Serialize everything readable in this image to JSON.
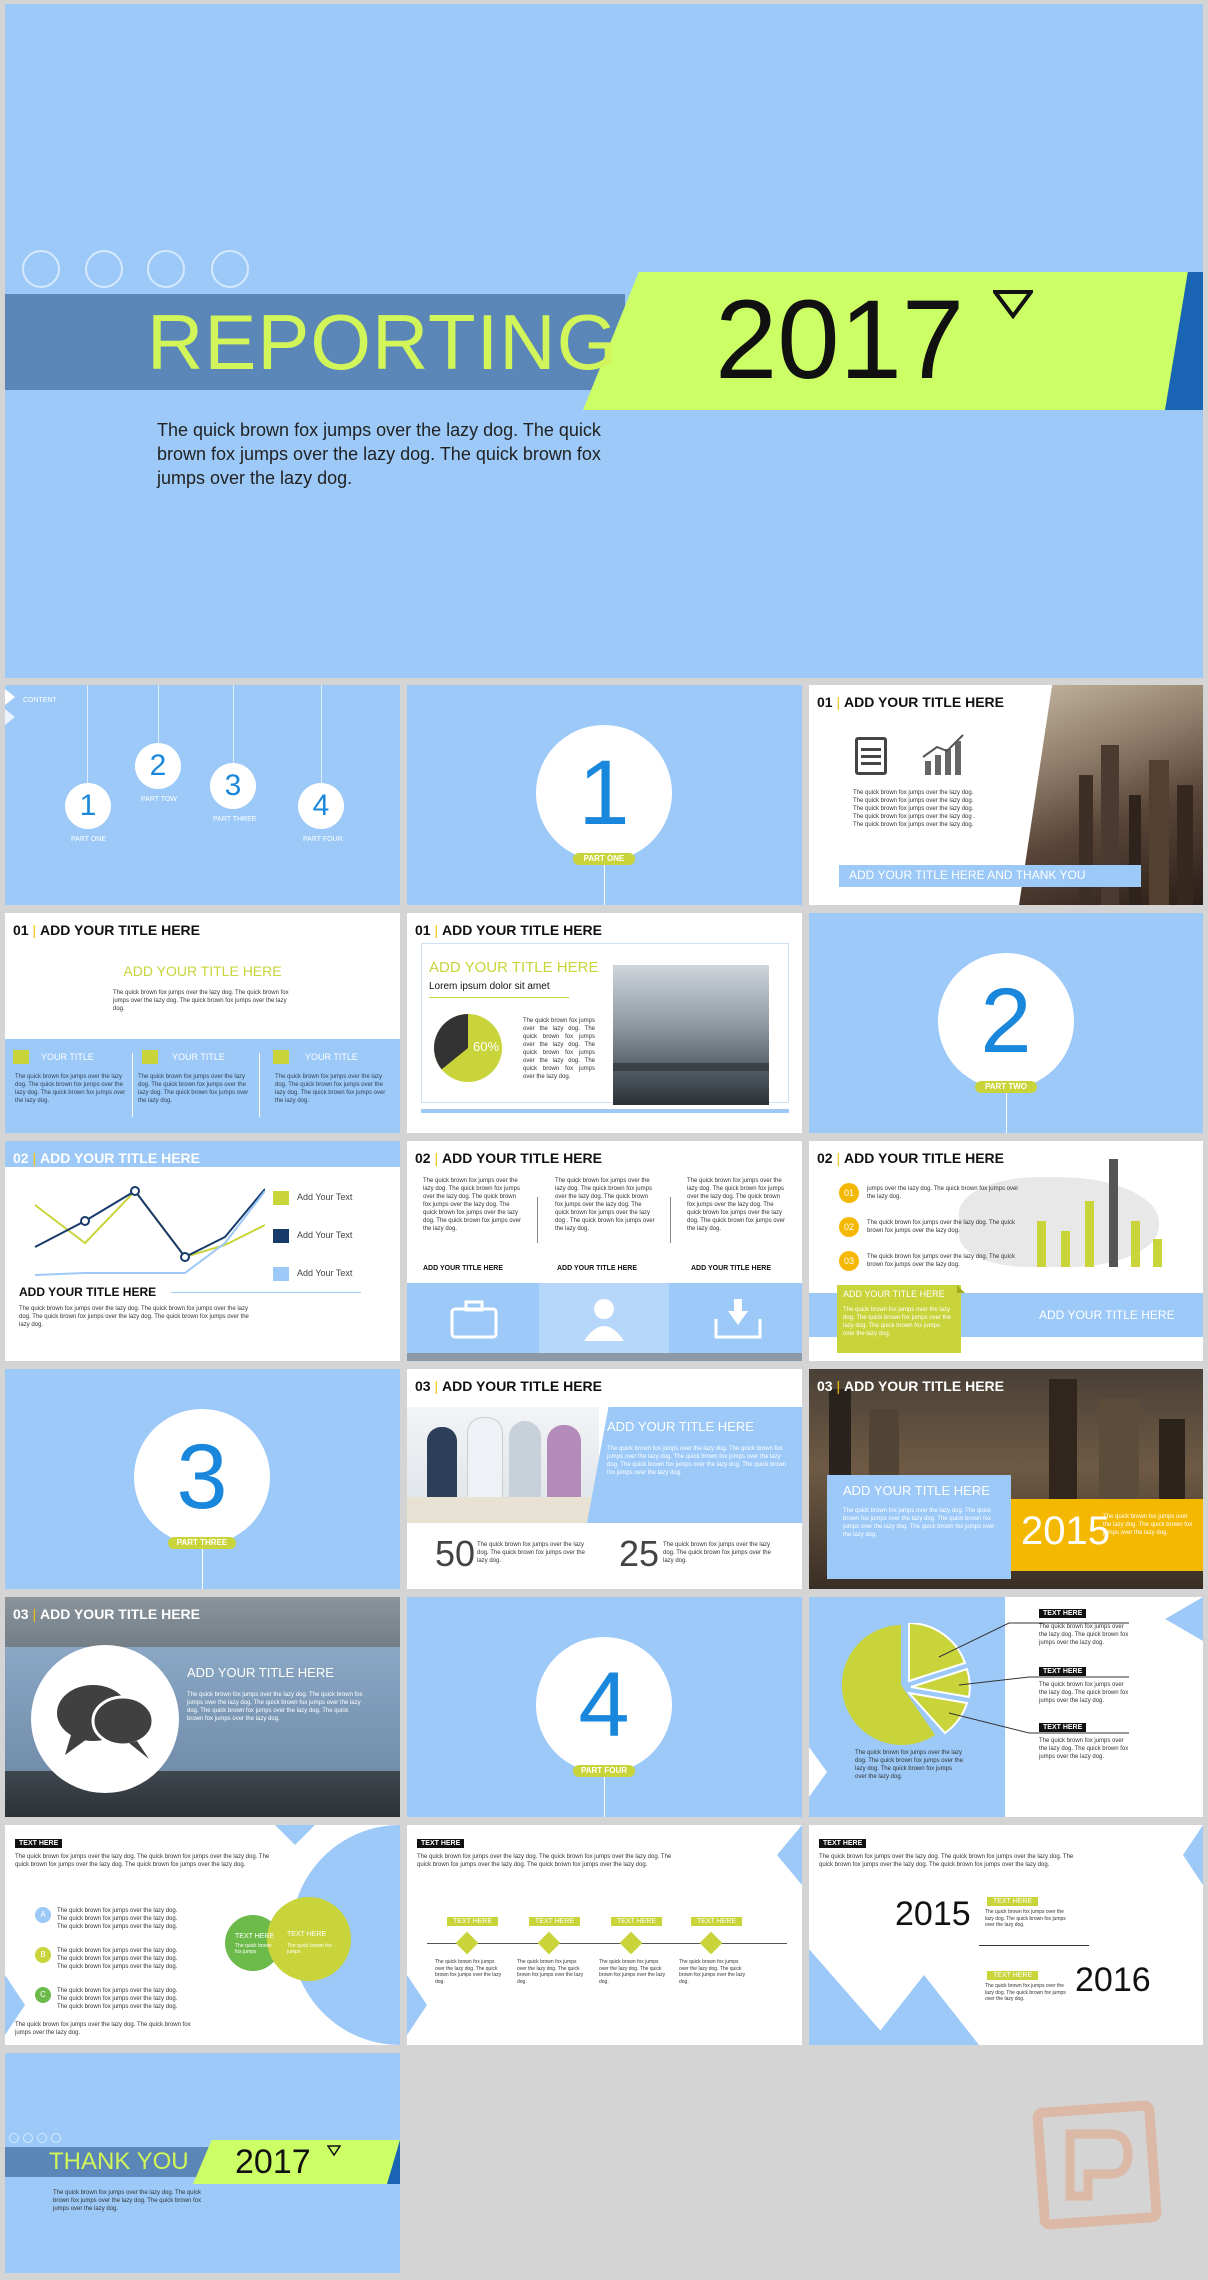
{
  "s1": {
    "title": "REPORTING",
    "year": "2017",
    "body": "The quick brown fox jumps over the lazy dog. The quick brown fox jumps over the lazy dog. The quick brown fox jumps over the lazy dog."
  },
  "s2": {
    "content": "CONTENT",
    "items": [
      {
        "n": "1",
        "label": "PART ONE"
      },
      {
        "n": "2",
        "label": "PART TOW"
      },
      {
        "n": "3",
        "label": "PART THREE"
      },
      {
        "n": "4",
        "label": "PART FOUR"
      }
    ]
  },
  "s3": {
    "n": "1",
    "label": "PART ONE"
  },
  "s4": {
    "num": "01",
    "title": "ADD YOUR TITLE HERE",
    "body": "The quick brown fox jumps over the lazy dog. The quick brown fox jumps over the lazy dog. The quick brown fox jumps over the lazy dog. The quick brown fox jumps over the lazy dog . The quick brown fox jumps over the lazy dog.",
    "banner": "ADD YOUR TITLE HERE AND THANK YOU"
  },
  "s5": {
    "num": "01",
    "title": "ADD YOUR TITLE HERE",
    "subtitle": "ADD YOUR TITLE HERE",
    "body": "The quick brown fox jumps over the lazy dog. The quick brown fox jumps over the lazy dog. The quick brown fox jumps over the lazy dog.",
    "cols": [
      {
        "label": "YOUR TITLE",
        "text": "The quick brown fox jumps over the lazy dog. The quick brown fox jumps over the lazy dog. The quick brown fox jumps over the lazy dog."
      },
      {
        "label": "YOUR TITLE",
        "text": "The quick brown fox jumps over the lazy dog. The quick brown fox jumps over the lazy dog. The quick brown fox jumps over the lazy dog."
      },
      {
        "label": "YOUR TITLE",
        "text": "The quick brown fox jumps over the lazy dog. The quick brown fox jumps over the lazy dog. The quick brown fox jumps over the lazy dog."
      }
    ]
  },
  "s6": {
    "num": "01",
    "title": "ADD YOUR TITLE HERE",
    "subtitle": "ADD YOUR TITLE HERE",
    "lorem": "Lorem ipsum dolor sit amet",
    "pct": "60%",
    "pct_value": 60,
    "body": "The quick brown fox jumps over the lazy dog. The quick brown fox jumps over the lazy dog. The quick brown fox jumps over the lazy dog. The quick brown fox jumps over the lazy dog."
  },
  "s7": {
    "n": "2",
    "label": "PART TWO"
  },
  "s8": {
    "num": "02",
    "title": "ADD YOUR TITLE HERE",
    "legend": [
      "Add Your Text",
      "Add Your Text",
      "Add Your Text"
    ],
    "subtitle": "ADD YOUR TITLE HERE",
    "body": "The quick brown fox jumps over the lazy dog. The quick brown fox jumps over the lazy dog. The quick brown fox jumps over the lazy dog. The quick brown fox jumps over the lazy dog."
  },
  "s9": {
    "num": "02",
    "title": "ADD YOUR TITLE HERE",
    "cols": [
      {
        "text": "The quick brown fox jumps over the lazy dog. The quick brown fox jumps over the lazy dog. The quick brown fox jumps over the lazy dog. The quick brown fox jumps over the lazy dog. The quick brown fox jumps over the lazy dog.",
        "label": "ADD YOUR TITLE HERE"
      },
      {
        "text": "The quick brown fox jumps over the lazy dog. The quick brown fox jumps over the lazy dog. The quick brown fox jumps over the lazy dog. The quick brown fox jumps over the lazy dog . The quick brown fox jumps over the lazy dog.",
        "label": "ADD YOUR TITLE HERE"
      },
      {
        "text": "The quick brown fox jumps over the lazy dog. The quick brown fox jumps over the lazy dog. The quick brown fox jumps over the lazy dog. The quick brown fox jumps over the lazy dog. The quick brown fox jumps over the lazy dog.",
        "label": "ADD YOUR TITLE HERE"
      }
    ]
  },
  "s10": {
    "num": "02",
    "title": "ADD YOUR TITLE HERE",
    "items": [
      {
        "n": "01",
        "text": "jumps over the lazy dog. The quick brown fox jumps over the lazy dog."
      },
      {
        "n": "02",
        "text": "The quick brown fox jumps over the lazy dog. The quick brown fox jumps over the lazy dog."
      },
      {
        "n": "03",
        "text": "The quick brown fox jumps over the lazy dog. The quick brown fox jumps over the lazy dog."
      }
    ],
    "box_title": "ADD YOUR TITLE HERE",
    "box_text": "The quick brown fox jumps over the lazy dog. The quick brown fox jumps over the lazy dog. The quick brown fox jumps over the lazy dog.",
    "right_title": "ADD YOUR TITLE HERE"
  },
  "s11": {
    "n": "3",
    "label": "PART THREE"
  },
  "s12": {
    "num": "03",
    "title": "ADD YOUR TITLE HERE",
    "subtitle": "ADD YOUR TITLE HERE",
    "body": "The quick brown fox jumps over the lazy dog. The quick brown fox jumps over the lazy dog. The quick brown fox jumps over the lazy dog. The quick brown fox jumps over the lazy dog. The quick brown fox jumps over the lazy dog.",
    "stats": [
      {
        "n": "50",
        "text": "The quick brown fox jumps over the lazy dog. The quick brown fox jumps over the lazy dog."
      },
      {
        "n": "25",
        "text": "The quick brown fox jumps over the lazy dog. The quick brown fox jumps over the lazy dog."
      }
    ]
  },
  "s13": {
    "num": "03",
    "title": "ADD YOUR TITLE HERE",
    "subtitle": "ADD YOUR TITLE HERE",
    "body": "The quick brown fox jumps over the lazy dog. The quick brown fox jumps over the lazy dog. The quick brown fox jumps over the lazy dog. The quick brown fox jumps over the lazy dog.",
    "year": "2015",
    "side": "The quick brown fox jumps over the lazy dog. The quick brown fox jumps over the lazy dog."
  },
  "s14": {
    "num": "03",
    "title": "ADD YOUR TITLE HERE",
    "subtitle": "ADD YOUR TITLE HERE",
    "body": "The quick brown fox jumps over the lazy dog. The quick brown fox jumps over the lazy dog. The quick brown fox jumps over the lazy dog. The quick brown fox jumps over the lazy dog. The quick brown fox jumps over the lazy dog."
  },
  "s15": {
    "n": "4",
    "label": "PART FOUR"
  },
  "s16": {
    "tags": [
      "TEXT HERE",
      "TEXT HERE",
      "TEXT HERE"
    ],
    "texts": [
      "The quick brown fox jumps over the lazy dog. The quick brown fox jumps over the lazy dog.",
      "The quick brown fox jumps over the lazy dog. The quick brown fox jumps over the lazy dog.",
      "The quick brown fox jumps over the lazy dog. The quick brown fox jumps over the lazy dog."
    ],
    "caption": "The quick brown fox jumps over the lazy dog. The quick brown fox jumps over the lazy dog. The quick brown fox jumps over the lazy dog."
  },
  "s17": {
    "tag": "TEXT HERE",
    "intro": "The quick brown fox jumps over the lazy dog. The quick brown fox jumps over the lazy dog. The quick brown fox jumps over the lazy dog. The quick brown fox jumps over the lazy dog.",
    "items": [
      {
        "l": "A",
        "t": "The quick brown fox jumps over the lazy dog. The quick brown fox jumps over the lazy dog. The quick brown fox jumps over the lazy dog."
      },
      {
        "l": "B",
        "t": "The quick brown fox jumps over the lazy dog. The quick brown fox jumps over the lazy dog. The quick brown fox jumps over the lazy dog."
      },
      {
        "l": "C",
        "t": "The quick brown fox jumps over the lazy dog. The quick brown fox jumps over the lazy dog. The quick brown fox jumps over the lazy dog."
      }
    ],
    "c1": "TEXT HERE",
    "c1s": "The quick brown fox jumps",
    "c2": "TEXT HERE",
    "c2s": "The quick brown fox jumps",
    "footer": "The quick brown fox jumps over the lazy dog. The quick brown fox jumps over the lazy dog."
  },
  "s18": {
    "tag": "TEXT HERE",
    "intro": "The quick brown fox jumps over the lazy dog. The quick brown fox jumps over the lazy dog. The quick brown fox jumps over the lazy dog. The quick brown fox jumps over the lazy dog.",
    "steps": [
      {
        "l": "TEXT HERE",
        "t": "The quick brown fox jumps over the lazy dog. The quick brown fox jumps over the lazy dog."
      },
      {
        "l": "TEXT HERE",
        "t": "The quick brown fox jumps over the lazy dog. The quick brown fox jumps over the lazy dog."
      },
      {
        "l": "TEXT HERE",
        "t": "The quick brown fox jumps over the lazy dog. The quick brown fox jumps over the lazy dog."
      },
      {
        "l": "TEXT HERE",
        "t": "The quick brown fox jumps over the lazy dog. The quick brown fox jumps over the lazy dog."
      }
    ]
  },
  "s19": {
    "tag": "TEXT HERE",
    "intro": "The quick brown fox jumps over the lazy dog. The quick brown fox jumps over the lazy dog. The quick brown fox jumps over the lazy dog. The quick brown fox jumps over the lazy dog.",
    "y1": "2015",
    "y2": "2016",
    "t1": "TEXT HERE",
    "t2": "TEXT HERE",
    "b1": "The quick brown fox jumps over the lazy dog. The quick brown fox jumps over the lazy dog.",
    "b2": "The quick brown fox jumps over the lazy dog. The quick brown fox jumps over the lazy dog."
  },
  "s20": {
    "title": "THANK YOU",
    "year": "2017",
    "body": "The quick brown fox jumps over the lazy dog. The quick brown fox jumps over the lazy dog. The quick brown fox jumps over the lazy dog."
  },
  "colors": {
    "light_blue": "#9cc9f8",
    "yellow_green": "#c8d43a",
    "lime": "#ccff66",
    "blue": "#1987dc",
    "steel": "#5b86b8"
  }
}
